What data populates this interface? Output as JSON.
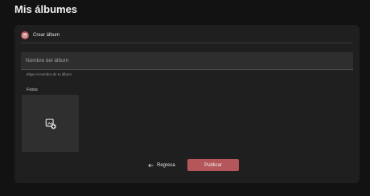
{
  "page": {
    "title": "Mis álbumes"
  },
  "card": {
    "header_label": "Crear álbum",
    "header_icon": "album-icon",
    "accent": "#b45a5a"
  },
  "form": {
    "name_placeholder": "Nombre del álbum",
    "name_value": "",
    "helper": "Elige el nombre de tu álbum",
    "photos_label": "Fotos",
    "add_photo_icon": "add-photo-icon"
  },
  "actions": {
    "back_label": "Regresa",
    "back_icon": "arrow-left-icon",
    "publish_label": "Publicar",
    "publish_color": "#b4565a"
  }
}
